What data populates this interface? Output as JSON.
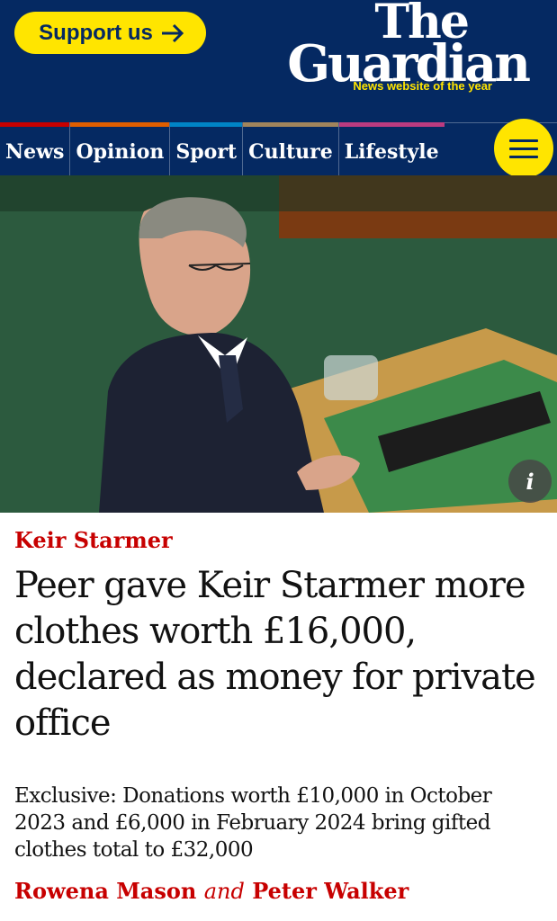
{
  "header": {
    "support_label": "Support us",
    "logo_the": "The",
    "logo_guardian": "Guardian",
    "award": "News website of the year"
  },
  "nav": {
    "items": [
      {
        "label": "News",
        "color": "#c70000"
      },
      {
        "label": "Opinion",
        "color": "#e05e00"
      },
      {
        "label": "Sport",
        "color": "#0084c6"
      },
      {
        "label": "Culture",
        "color": "#a1845c"
      },
      {
        "label": "Lifestyle",
        "color": "#bb3b80"
      }
    ],
    "menu_icon": "hamburger-menu-icon"
  },
  "hero": {
    "info_label": "i"
  },
  "article": {
    "kicker": "Keir Starmer",
    "headline": "Peer gave Keir Starmer more clothes worth £16,000, declared as money for private office",
    "standfirst": "Exclusive: Donations worth £10,000 in October 2023 and £6,000 in February 2024 bring gifted clothes total to £32,000",
    "author1": "Rowena Mason",
    "and": "and",
    "author2": "Peter Walker"
  },
  "colors": {
    "brand_blue": "#052962",
    "support_yellow": "#ffe500",
    "kicker_red": "#c70000"
  }
}
